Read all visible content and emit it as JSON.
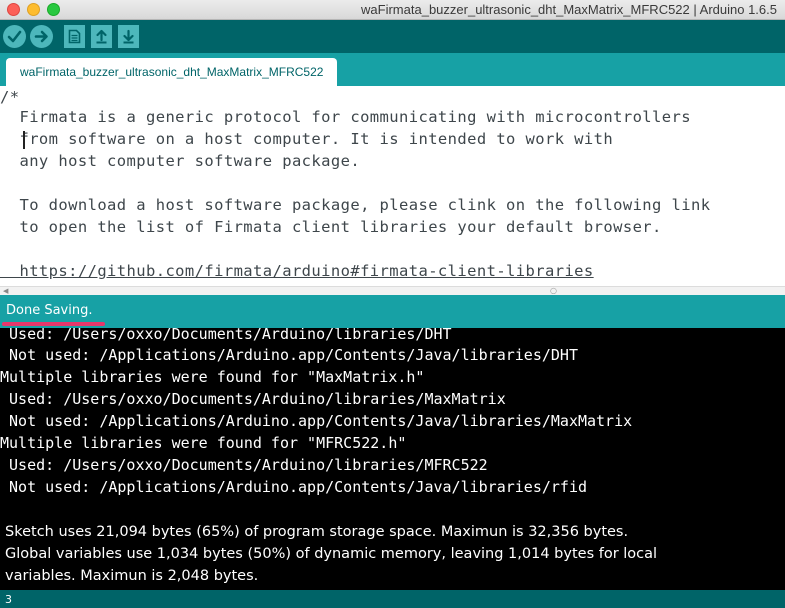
{
  "window": {
    "title": "waFirmata_buzzer_ultrasonic_dht_MaxMatrix_MFRC522 | Arduino 1.6.5"
  },
  "toolbar": {
    "buttons": [
      {
        "name": "verify",
        "icon": "check-icon"
      },
      {
        "name": "upload",
        "icon": "arrow-right-icon"
      },
      {
        "name": "new",
        "icon": "document-icon"
      },
      {
        "name": "open",
        "icon": "arrow-up-icon"
      },
      {
        "name": "save",
        "icon": "arrow-down-icon"
      }
    ]
  },
  "tabs": [
    {
      "label": "waFirmata_buzzer_ultrasonic_dht_MaxMatrix_MFRC522"
    }
  ],
  "editor": {
    "lines": [
      "/*",
      "  Firmata is a generic protocol for communicating with microcontrollers",
      "  from software on a host computer. It is intended to work with",
      "  any host computer software package.",
      "",
      "  To download a host software package, please clink on the following link",
      "  to open the list of Firmata client libraries your default browser.",
      "",
      "  https://github.com/firmata/arduino#firmata-client-libraries"
    ]
  },
  "status": {
    "text": "Done Saving."
  },
  "console": {
    "lines": [
      " Used: /Users/oxxo/Documents/Arduino/libraries/DHT",
      " Not used: /Applications/Arduino.app/Contents/Java/libraries/DHT",
      "Multiple libraries were found for \"MaxMatrix.h\"",
      " Used: /Users/oxxo/Documents/Arduino/libraries/MaxMatrix",
      " Not used: /Applications/Arduino.app/Contents/Java/libraries/MaxMatrix",
      "Multiple libraries were found for \"MFRC522.h\"",
      " Used: /Users/oxxo/Documents/Arduino/libraries/MFRC522",
      " Not used: /Applications/Arduino.app/Contents/Java/libraries/rfid"
    ],
    "messages": [
      "Sketch uses 21,094 bytes (65%) of program storage space. Maximun is 32,356 bytes.",
      "Global variables use 1,034 bytes (50%) of dynamic memory, leaving 1,014 bytes for local",
      "variables. Maximun is 2,048 bytes."
    ]
  },
  "footer": {
    "line_number": "3"
  },
  "colors": {
    "toolbar": "#006468",
    "tabstrip": "#17a1a5",
    "button": "#4db7bb",
    "status_underline": "#e6376b",
    "console_bg": "#000000"
  }
}
